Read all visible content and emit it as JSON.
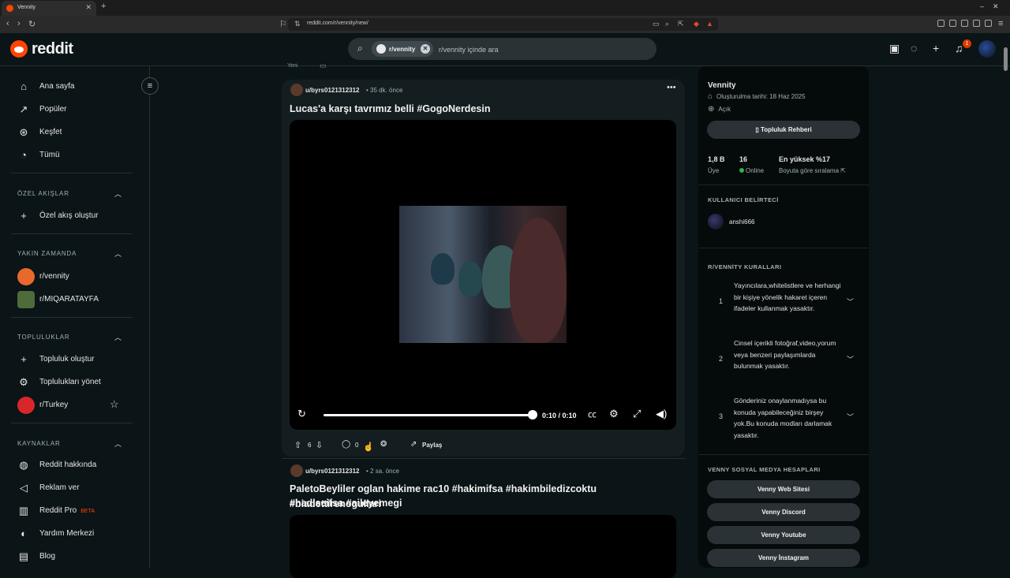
{
  "browser": {
    "tab_title": "Vennity",
    "url": "reddit.com/r/vennity/new/"
  },
  "header": {
    "logo": "reddit",
    "search_chip": "r/vennity",
    "search_placeholder": "r/vennity içinde ara",
    "notification_count": "1"
  },
  "sidebar": {
    "main": [
      {
        "label": "Ana sayfa",
        "icon": "home-icon"
      },
      {
        "label": "Popüler",
        "icon": "popular-icon"
      },
      {
        "label": "Keşfet",
        "icon": "explore-icon"
      },
      {
        "label": "Tümü",
        "icon": "all-icon"
      }
    ],
    "custom_feeds": {
      "title": "ÖZEL AKIŞLAR",
      "create": "Özel akış oluştur"
    },
    "recent": {
      "title": "YAKIN ZAMANDA",
      "items": [
        "r/vennity",
        "r/MIQARATAYFA"
      ]
    },
    "communities": {
      "title": "TOPLULUKLAR",
      "create": "Topluluk oluştur",
      "manage": "Toplulukları yönet",
      "items": [
        "r/Turkey"
      ]
    },
    "resources": {
      "title": "KAYNAKLAR",
      "items": [
        "Reddit hakkında",
        "Reklam ver",
        "Reddit Pro",
        "Yardım Merkezi",
        "Blog"
      ],
      "beta": "BETA"
    }
  },
  "feed": {
    "partial_label": "Yeni",
    "posts": [
      {
        "user": "u/byrs0121312312",
        "time": "• 35 dk. önce",
        "title": "Lucas'a karşı tavrımız belli #GogoNerdesin",
        "video_time": "0:10 / 0:10",
        "progress_fraction": 1.0,
        "votes": "6",
        "comments": "0",
        "share": "Paylaş"
      },
      {
        "user": "u/byrs0121312312",
        "time": "• 2 sa. önce",
        "title_line1": "PaletoBeyliler oglan hakime rac10 #hakimifsa #hakimbiledizcoktu #biadettirenogullari",
        "title_line2": "#hadiseifsa #aileyemegi"
      }
    ]
  },
  "community": {
    "name": "Vennity",
    "created": "Oluşturulma tarihi: 18 Haz 2025",
    "visibility": "Açık",
    "guide_button": "Topluluk Rehberi",
    "stats": [
      {
        "value": "1,8 B",
        "label": "Üye"
      },
      {
        "value": "16",
        "label": "Online"
      },
      {
        "value": "En yüksek %17",
        "label": "Boyuta göre sıralama"
      }
    ],
    "flair_title": "KULLANICI BELİRTECİ",
    "flair_user": "anshi666",
    "rules_title": "R/VENNİTY KURALLARI",
    "rules": [
      {
        "num": "1",
        "text": "Yayıncılara,whitelistlere ve herhangi bir kişiye yönelik hakaret içeren ifadeler kullanmak yasaktır."
      },
      {
        "num": "2",
        "text": "Cinsel içerikli fotoğraf,video,yorum veya benzeri paylaşımlarda bulunmak yasaktır."
      },
      {
        "num": "3",
        "text": "Gönderiniz onaylanmadıysa bu konuda yapabileceğiniz birşey yok.Bu konuda modları darlamak yasaktır."
      }
    ],
    "social_title": "VENNY SOSYAL MEDYA HESAPLARI",
    "social_links": [
      "Venny Web Sitesi",
      "Venny Discord",
      "Venny Youtube",
      "Venny İnstagram"
    ]
  },
  "colors": {
    "accent": "#ff4500",
    "online": "#2ab549",
    "bg": "#0b1416"
  }
}
